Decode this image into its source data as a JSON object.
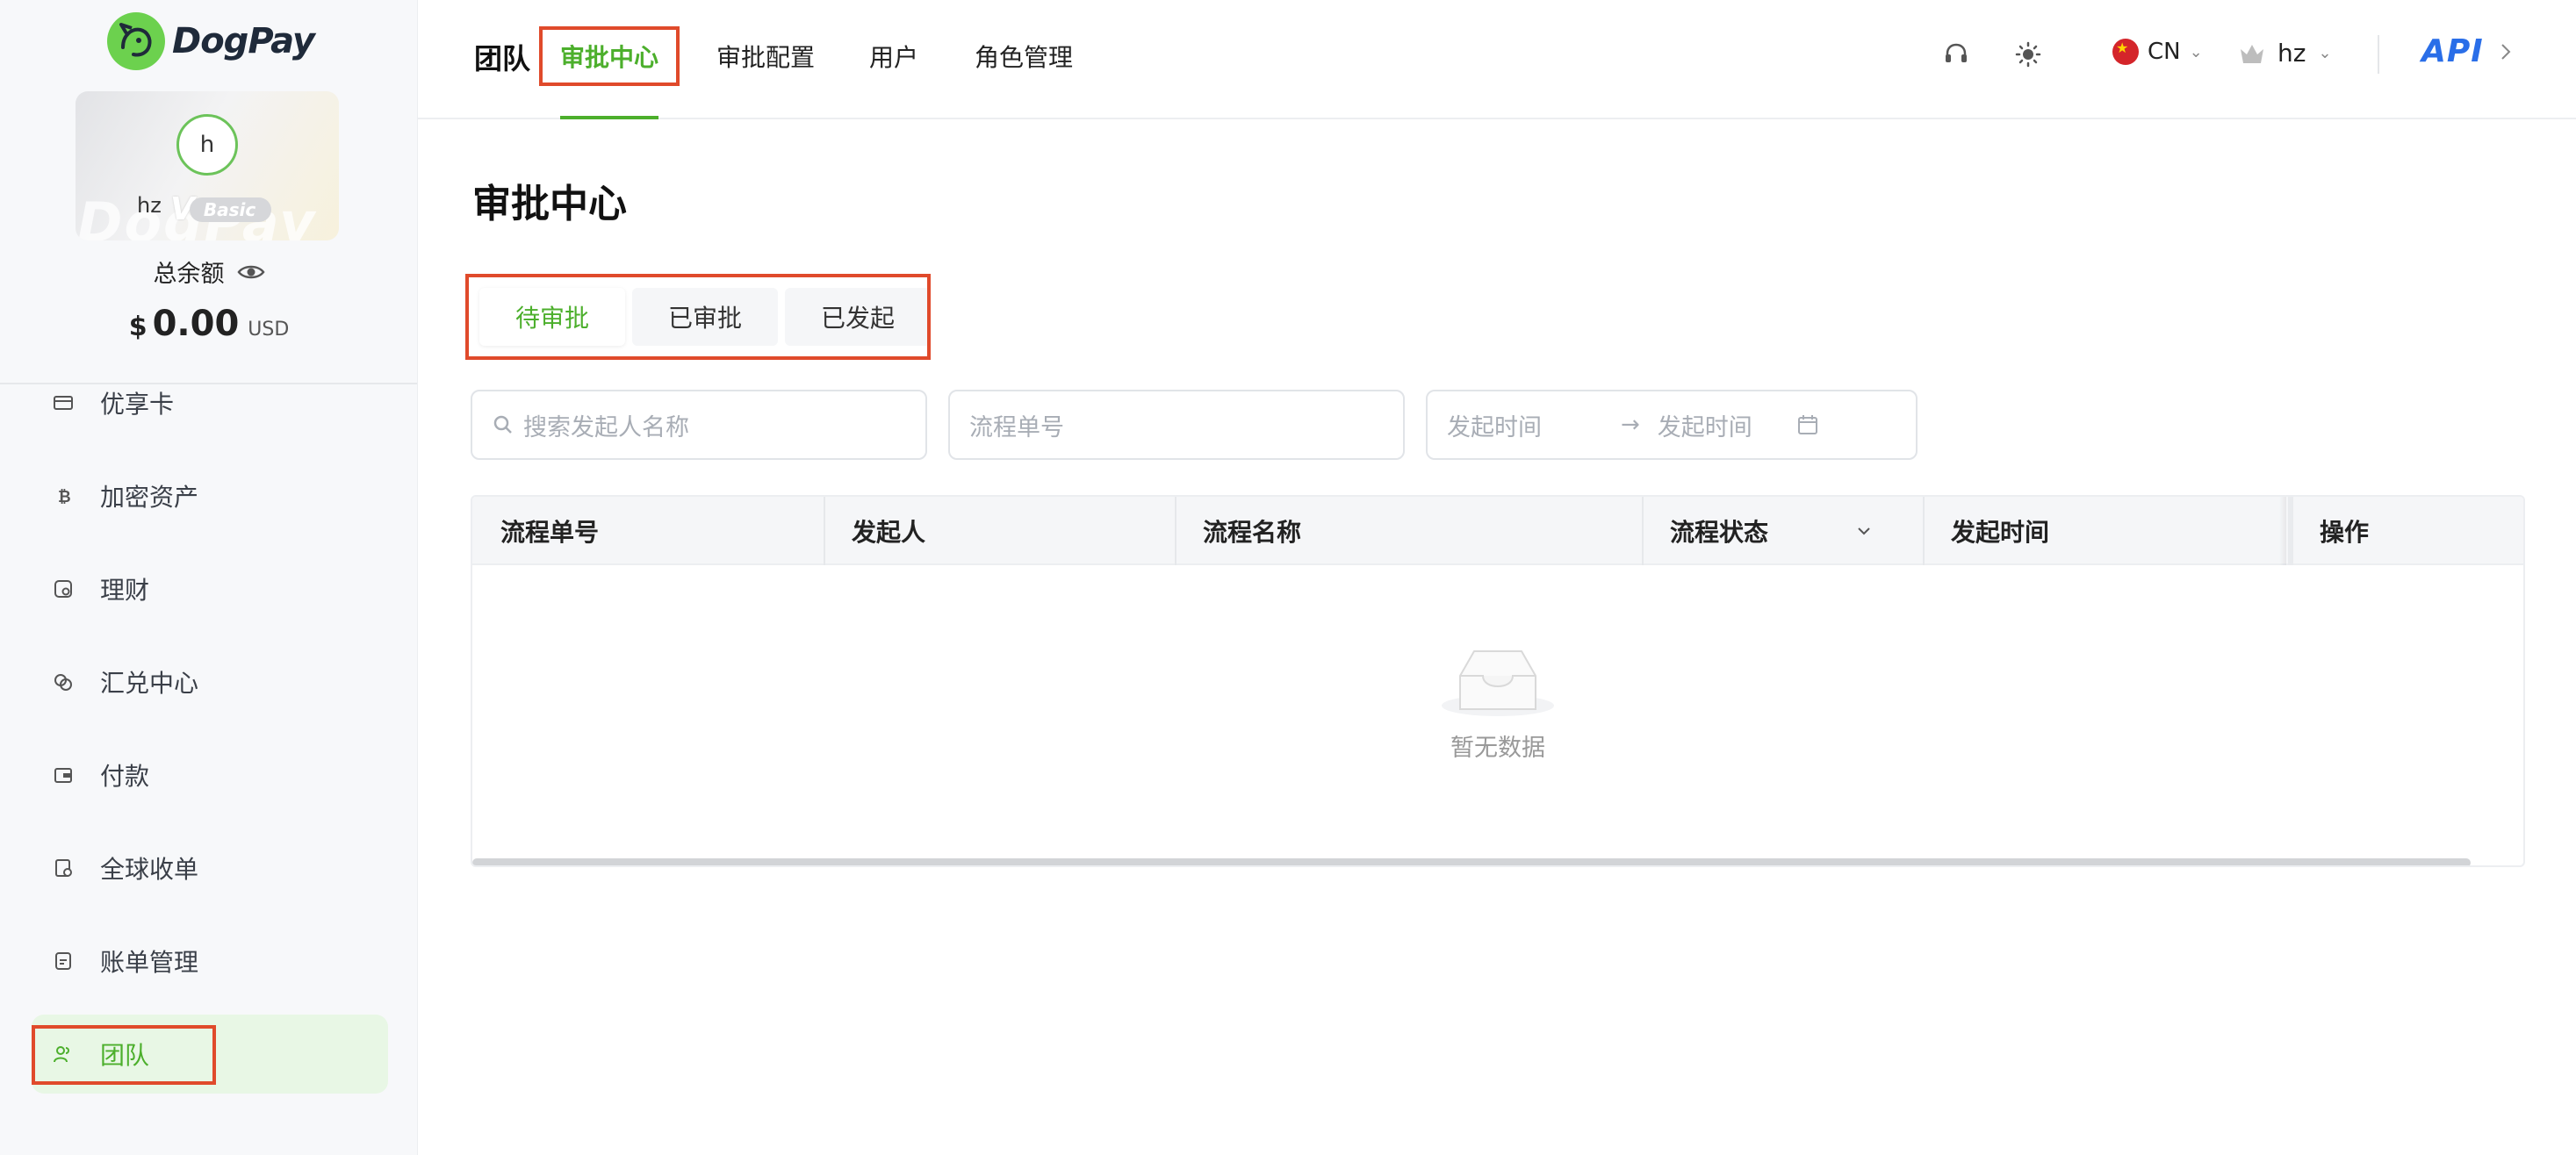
{
  "brand": {
    "name": "DogPay"
  },
  "profile": {
    "avatar_initial": "h",
    "username": "hz",
    "vip_letter": "V",
    "vip_level": "Basic",
    "balance_label": "总余额",
    "balance_currency_symbol": "$",
    "balance_value": "0.00",
    "balance_unit": "USD"
  },
  "sidebar": {
    "items": [
      {
        "label": "优享卡",
        "icon": "card-icon"
      },
      {
        "label": "加密资产",
        "icon": "bitcoin-icon"
      },
      {
        "label": "理财",
        "icon": "finance-icon"
      },
      {
        "label": "汇兑中心",
        "icon": "exchange-icon"
      },
      {
        "label": "付款",
        "icon": "wallet-icon"
      },
      {
        "label": "全球收单",
        "icon": "receipt-icon"
      },
      {
        "label": "账单管理",
        "icon": "bill-icon"
      },
      {
        "label": "团队",
        "icon": "team-icon",
        "active": true
      }
    ]
  },
  "topbar": {
    "group_title": "团队",
    "tabs": [
      "审批中心",
      "审批配置",
      "用户",
      "角色管理"
    ],
    "active_tab": "审批中心",
    "language": "CN",
    "user": "hz",
    "api_label": "API"
  },
  "page": {
    "title": "审批中心",
    "segments": [
      "待审批",
      "已审批",
      "已发起"
    ],
    "active_segment": "待审批"
  },
  "filters": {
    "search_placeholder": "搜索发起人名称",
    "flow_no_placeholder": "流程单号",
    "start_time_placeholder": "发起时间",
    "end_time_placeholder": "发起时间",
    "range_arrow": "→"
  },
  "table": {
    "columns": [
      "流程单号",
      "发起人",
      "流程名称",
      "流程状态",
      "发起时间",
      "操作"
    ],
    "rows": [],
    "empty_text": "暂无数据"
  },
  "colors": {
    "accent": "#4caf2c",
    "highlight": "#e04a2b",
    "api": "#2a6ee8"
  }
}
